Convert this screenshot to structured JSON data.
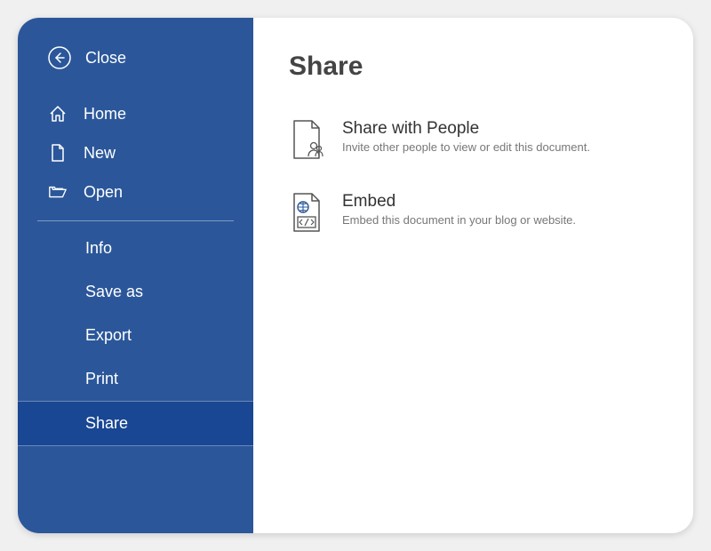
{
  "sidebar": {
    "close_label": "Close",
    "primary": [
      {
        "label": "Home"
      },
      {
        "label": "New"
      },
      {
        "label": "Open"
      }
    ],
    "secondary": [
      {
        "label": "Info"
      },
      {
        "label": "Save as"
      },
      {
        "label": "Export"
      },
      {
        "label": "Print"
      },
      {
        "label": "Share"
      }
    ]
  },
  "main": {
    "heading": "Share",
    "options": [
      {
        "title": "Share with People",
        "desc": "Invite other people to view or edit this document."
      },
      {
        "title": "Embed",
        "desc": "Embed this document in your blog or website."
      }
    ]
  }
}
